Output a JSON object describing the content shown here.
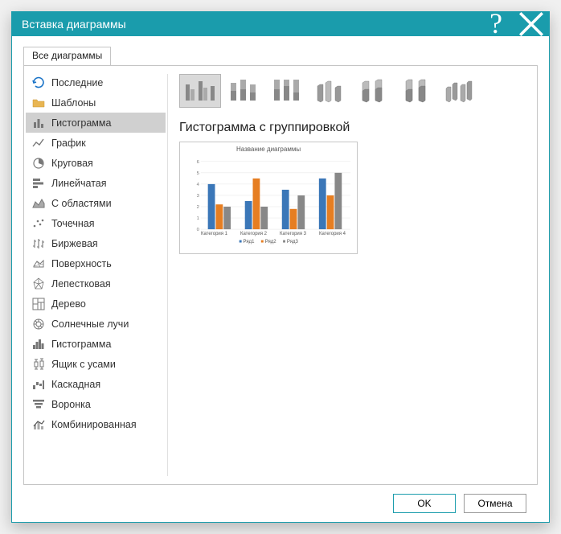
{
  "window": {
    "title": "Вставка диаграммы"
  },
  "tabs": {
    "all": "Все диаграммы"
  },
  "sidebar": {
    "items": [
      {
        "label": "Последние"
      },
      {
        "label": "Шаблоны"
      },
      {
        "label": "Гистограмма"
      },
      {
        "label": "График"
      },
      {
        "label": "Круговая"
      },
      {
        "label": "Линейчатая"
      },
      {
        "label": "С областями"
      },
      {
        "label": "Точечная"
      },
      {
        "label": "Биржевая"
      },
      {
        "label": "Поверхность"
      },
      {
        "label": "Лепестковая"
      },
      {
        "label": "Дерево"
      },
      {
        "label": "Солнечные лучи"
      },
      {
        "label": "Гистограмма"
      },
      {
        "label": "Ящик с усами"
      },
      {
        "label": "Каскадная"
      },
      {
        "label": "Воронка"
      },
      {
        "label": "Комбинированная"
      }
    ],
    "selected_index": 2
  },
  "subtypes": {
    "selected_index": 0,
    "count": 7
  },
  "chart_label": "Гистограмма с группировкой",
  "preview": {
    "title": "Название диаграммы",
    "legend": [
      "Ряд1",
      "Ряд2",
      "Ряд3"
    ],
    "categories": [
      "Категория 1",
      "Категория 2",
      "Категория 3",
      "Категория 4"
    ]
  },
  "chart_data": {
    "type": "bar",
    "title": "Название диаграммы",
    "categories": [
      "Категория 1",
      "Категория 2",
      "Категория 3",
      "Категория 4"
    ],
    "series": [
      {
        "name": "Ряд1",
        "values": [
          4.0,
          2.5,
          3.5,
          4.5
        ],
        "color": "#3b77b8"
      },
      {
        "name": "Ряд2",
        "values": [
          2.2,
          4.5,
          1.8,
          3.0
        ],
        "color": "#e67e22"
      },
      {
        "name": "Ряд3",
        "values": [
          2.0,
          2.0,
          3.0,
          5.0
        ],
        "color": "#888888"
      }
    ],
    "xlabel": "",
    "ylabel": "",
    "ylim": [
      0,
      6
    ],
    "yticks": [
      0,
      1,
      2,
      3,
      4,
      5,
      6
    ]
  },
  "buttons": {
    "ok": "OK",
    "cancel": "Отмена"
  }
}
